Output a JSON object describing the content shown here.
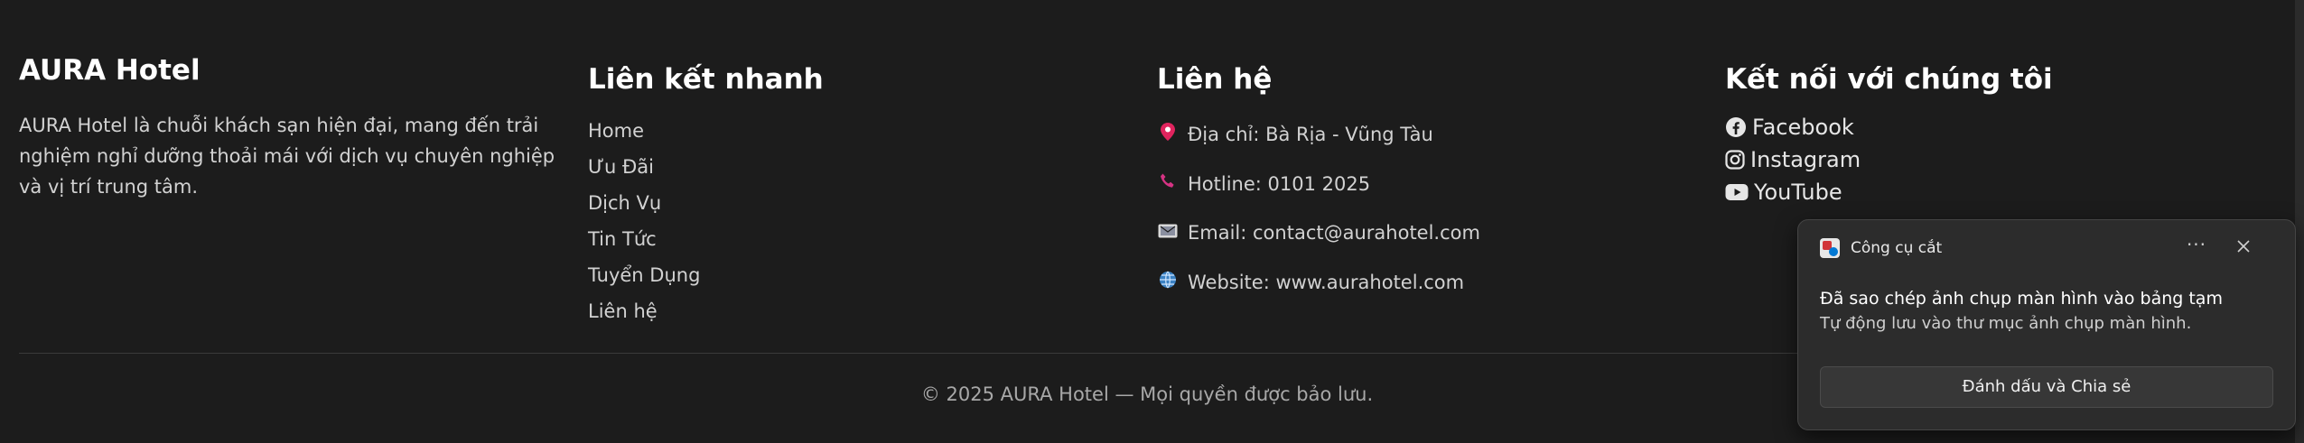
{
  "about": {
    "title": "AURA Hotel",
    "description": "AURA Hotel là chuỗi khách sạn hiện đại, mang đến trải nghiệm nghỉ dưỡng thoải mái với dịch vụ chuyên nghiệp và vị trí trung tâm."
  },
  "quick_links": {
    "title": "Liên kết nhanh",
    "items": [
      {
        "label": "Home"
      },
      {
        "label": "Ưu Đãi"
      },
      {
        "label": "Dịch Vụ"
      },
      {
        "label": "Tin Tức"
      },
      {
        "label": "Tuyển Dụng"
      },
      {
        "label": "Liên hệ"
      }
    ]
  },
  "contact": {
    "title": "Liên hệ",
    "items": [
      {
        "icon": "map-pin-icon",
        "text": "Địa chỉ: Bà Rịa - Vũng Tàu"
      },
      {
        "icon": "phone-icon",
        "text": "Hotline: 0101 2025"
      },
      {
        "icon": "envelope-icon",
        "text": "Email: contact@aurahotel.com"
      },
      {
        "icon": "globe-icon",
        "text": "Website: www.aurahotel.com"
      }
    ]
  },
  "social": {
    "title": "Kết nối với chúng tôi",
    "items": [
      {
        "icon": "facebook-icon",
        "label": "Facebook"
      },
      {
        "icon": "instagram-icon",
        "label": "Instagram"
      },
      {
        "icon": "youtube-icon",
        "label": "YouTube"
      }
    ]
  },
  "copyright": "© 2025 AURA Hotel — Mọi quyền được bảo lưu.",
  "toast": {
    "app_name": "Công cụ cắt",
    "more_label": "···",
    "title": "Đã sao chép ảnh chụp màn hình vào bảng tạm",
    "body": "Tự động lưu vào thư mục ảnh chụp màn hình.",
    "button_label": "Đánh dấu và Chia sẻ"
  },
  "colors": {
    "background": "#1c1c1c",
    "heading": "#ffffff",
    "text": "#d2d2d2",
    "pin": "#e0245e",
    "phone": "#d63384",
    "toast_bg": "#2c2c2c"
  }
}
